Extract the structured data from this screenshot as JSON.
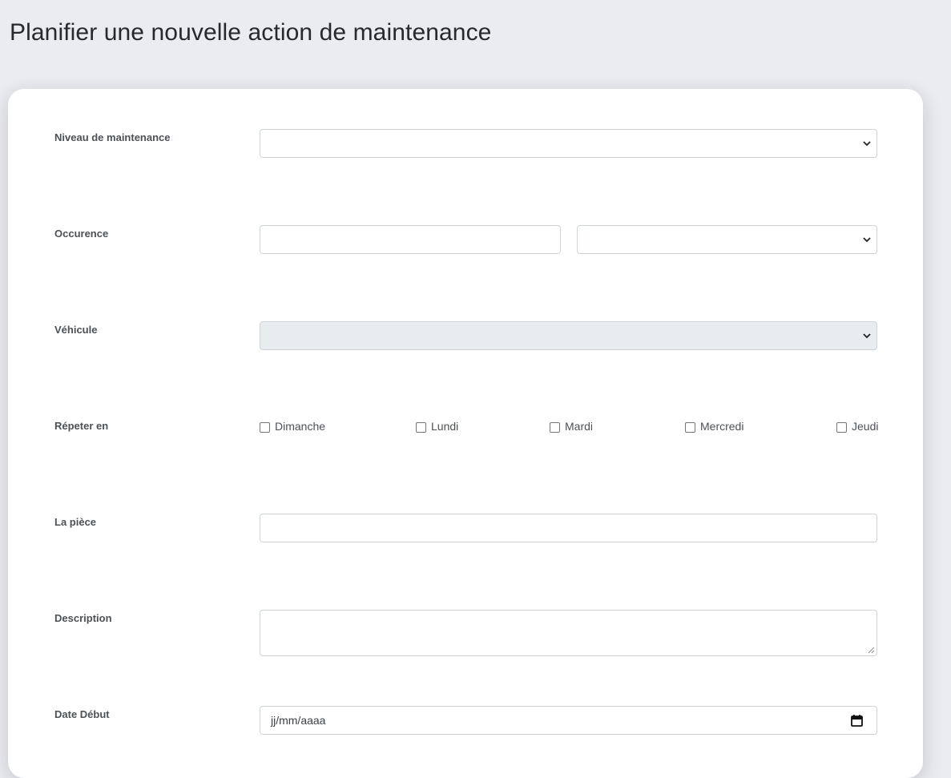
{
  "page": {
    "title": "Planifier une nouvelle action de maintenance"
  },
  "form": {
    "maintenance_level": {
      "label": "Niveau de maintenance",
      "value": ""
    },
    "occurrence": {
      "label": "Occurence",
      "number_value": "",
      "unit_value": ""
    },
    "vehicle": {
      "label": "Véhicule",
      "value": ""
    },
    "repeat": {
      "label": "Répeter en",
      "days": [
        {
          "label": "Dimanche",
          "checked": false
        },
        {
          "label": "Lundi",
          "checked": false
        },
        {
          "label": "Mardi",
          "checked": false
        },
        {
          "label": "Mercredi",
          "checked": false
        },
        {
          "label": "Jeudi",
          "checked": false
        }
      ]
    },
    "part": {
      "label": "La pièce",
      "value": ""
    },
    "description": {
      "label": "Description",
      "value": ""
    },
    "start_date": {
      "label": "Date Début",
      "placeholder": "jj/mm/aaaa"
    }
  },
  "icons": {
    "select_chevron": "chevron-down-icon",
    "calendar": "calendar-icon"
  }
}
